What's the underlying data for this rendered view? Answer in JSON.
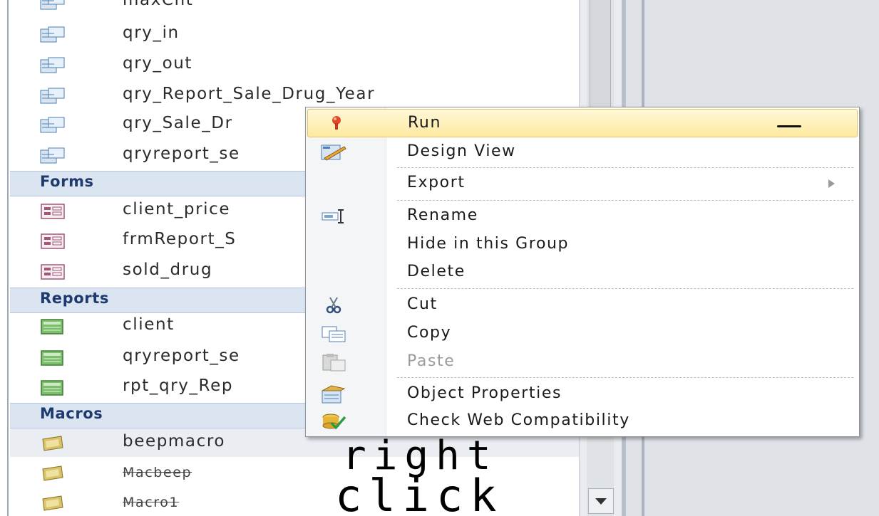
{
  "nav": {
    "items_top": [
      {
        "label": "maxCnt",
        "icon": "query-icon"
      },
      {
        "label": "qry_in",
        "icon": "query-icon"
      },
      {
        "label": "qry_out",
        "icon": "query-icon"
      },
      {
        "label": "qry_Report_Sale_Drug_Year",
        "icon": "query-icon"
      },
      {
        "label": "qry_Sale_Dr",
        "icon": "query-icon"
      },
      {
        "label": "qryreport_se",
        "icon": "query-icon"
      }
    ],
    "groups": {
      "forms": {
        "title": "Forms",
        "items": [
          "client_price",
          "frmReport_S",
          "sold_drug"
        ]
      },
      "reports": {
        "title": "Reports",
        "items": [
          "client",
          "qryreport_se",
          "rpt_qry_Rep"
        ]
      },
      "macros": {
        "title": "Macros",
        "items": [
          "beepmacro",
          "Macbeep",
          "Macro1"
        ]
      }
    }
  },
  "context_menu": {
    "items": [
      {
        "label": "Run",
        "icon": "run-icon",
        "state": "hover"
      },
      {
        "label": "Design View",
        "icon": "design-view-icon"
      },
      {
        "label": "Export",
        "icon": "",
        "submenu": true
      },
      {
        "label": "Rename",
        "icon": "rename-icon"
      },
      {
        "label": "Hide in this Group",
        "icon": ""
      },
      {
        "label": "Delete",
        "icon": ""
      },
      {
        "label": "Cut",
        "icon": "scissors-icon"
      },
      {
        "label": "Copy",
        "icon": "copy-icon"
      },
      {
        "label": "Paste",
        "icon": "paste-icon",
        "disabled": true
      },
      {
        "label": "Object Properties",
        "icon": "properties-icon"
      },
      {
        "label": "Check Web Compatibility",
        "icon": "web-compatibility-icon"
      }
    ]
  },
  "annotation": {
    "line1": "right",
    "line2": "click"
  },
  "colors": {
    "group_header_bg": "#dbe5f1",
    "group_header_text": "#1e3a6e",
    "hover_bg": "#fde9a0"
  }
}
